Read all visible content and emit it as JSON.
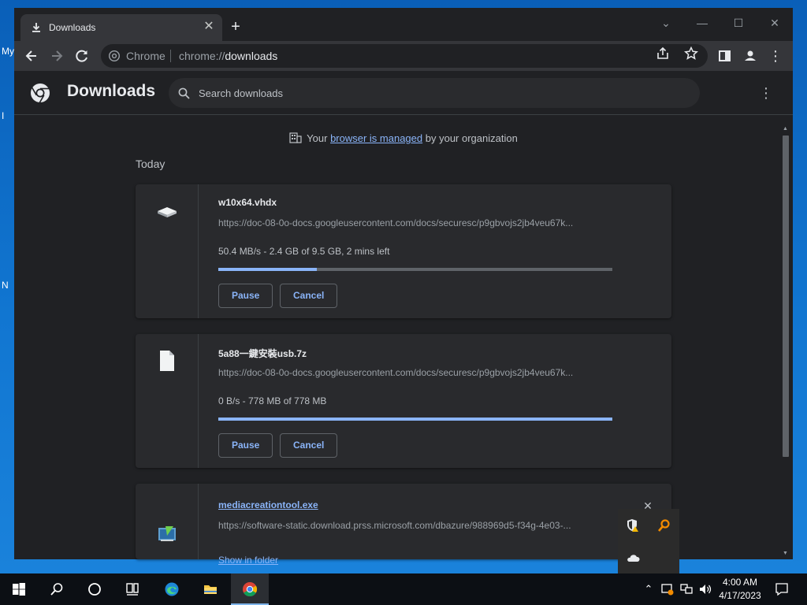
{
  "desktop": {
    "fragments": [
      "My",
      "I",
      "N"
    ]
  },
  "browser": {
    "tab_title": "Downloads",
    "new_tab": "+",
    "omnibox_chip": "Chrome",
    "url_scheme": "chrome://",
    "url_host": "downloads"
  },
  "downloads": {
    "title": "Downloads",
    "search_placeholder": "Search downloads",
    "managed": {
      "prefix": "Your",
      "link": "browser is managed",
      "suffix": "by your organization"
    },
    "section": "Today",
    "items": [
      {
        "name": "w10x64.vhdx",
        "url": "https://doc-08-0o-docs.googleusercontent.com/docs/securesc/p9gbvojs2jb4veu67k...",
        "status": "50.4 MB/s - 2.4 GB of 9.5 GB, 2 mins left",
        "progress": 0.25,
        "pause": "Pause",
        "cancel": "Cancel",
        "icon": "disk-drive-icon"
      },
      {
        "name": "5a88一鍵安裝usb.7z",
        "url": "https://doc-08-0o-docs.googleusercontent.com/docs/securesc/p9gbvojs2jb4veu67k...",
        "status": "0 B/s - 778 MB of 778 MB",
        "progress": 1.0,
        "pause": "Pause",
        "cancel": "Cancel",
        "icon": "file-icon"
      },
      {
        "name": "mediacreationtool.exe",
        "url": "https://software-static.download.prss.microsoft.com/dbazure/988969d5-f34g-4e03-...",
        "show_in_folder": "Show in folder",
        "icon": "installer-icon"
      }
    ]
  },
  "taskbar": {
    "time": "4:00 AM",
    "date": "4/17/2023"
  },
  "colors": {
    "accent": "#8ab4f8",
    "page_bg": "#202124",
    "card_bg": "#292a2d",
    "taskbar": "#0c0f14"
  }
}
